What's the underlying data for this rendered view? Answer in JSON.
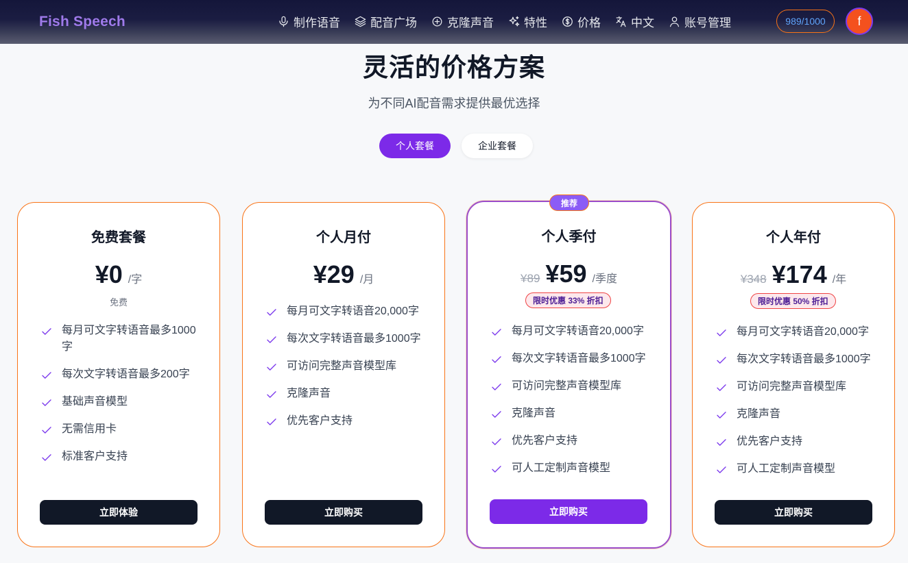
{
  "nav": {
    "logo": "Fish Speech",
    "items": [
      {
        "label": "制作语音",
        "icon": "microphone-icon"
      },
      {
        "label": "配音广场",
        "icon": "layers-icon"
      },
      {
        "label": "克隆声音",
        "icon": "plus-circle-icon"
      },
      {
        "label": "特性",
        "icon": "sparkles-icon"
      },
      {
        "label": "价格",
        "icon": "dollar-circle-icon"
      },
      {
        "label": "中文",
        "icon": "translate-icon"
      },
      {
        "label": "账号管理",
        "icon": "user-icon"
      }
    ],
    "credits": "989/1000",
    "avatar_letter": "f"
  },
  "header": {
    "title": "灵活的价格方案",
    "subtitle": "为不同AI配音需求提供最优选择"
  },
  "plan_toggle": {
    "personal": "个人套餐",
    "enterprise": "企业套餐",
    "selected": "personal"
  },
  "plans": [
    {
      "title": "免费套餐",
      "price": "¥0",
      "unit": "/字",
      "note": "免费",
      "features": [
        "每月可文字转语音最多1000字",
        "每次文字转语音最多200字",
        "基础声音模型",
        "无需信用卡",
        "标准客户支持"
      ],
      "cta": "立即体验"
    },
    {
      "title": "个人月付",
      "price": "¥29",
      "unit": "/月",
      "features": [
        "每月可文字转语音20,000字",
        "每次文字转语音最多1000字",
        "可访问完整声音模型库",
        "克隆声音",
        "优先客户支持"
      ],
      "cta": "立即购买"
    },
    {
      "title": "个人季付",
      "badge": "推荐",
      "original_price": "¥89",
      "price": "¥59",
      "unit": "/季度",
      "discount": "限时优惠 33% 折扣",
      "features": [
        "每月可文字转语音20,000字",
        "每次文字转语音最多1000字",
        "可访问完整声音模型库",
        "克隆声音",
        "优先客户支持",
        "可人工定制声音模型"
      ],
      "cta": "立即购买"
    },
    {
      "title": "个人年付",
      "original_price": "¥348",
      "price": "¥174",
      "unit": "/年",
      "discount": "限时优惠 50% 折扣",
      "features": [
        "每月可文字转语音20,000字",
        "每次文字转语音最多1000字",
        "可访问完整声音模型库",
        "克隆声音",
        "优先客户支持",
        "可人工定制声音模型"
      ],
      "cta": "立即购买"
    }
  ],
  "colors": {
    "accent": "#7c2ae8",
    "card_border": "#f97316",
    "check": "#7c3aed",
    "cta_dark": "#111827"
  }
}
